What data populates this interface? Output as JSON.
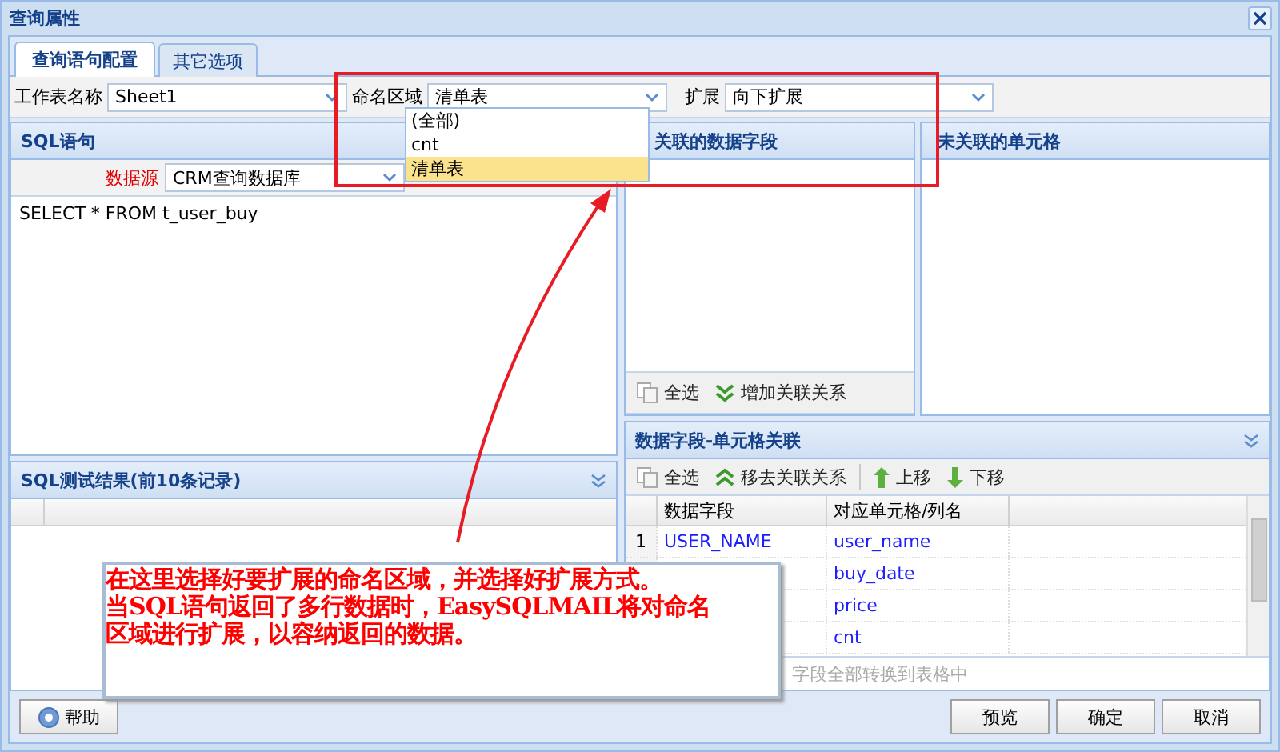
{
  "window": {
    "title": "查询属性"
  },
  "tabs": [
    {
      "label": "查询语句配置",
      "selected": true
    },
    {
      "label": "其它选项",
      "selected": false
    }
  ],
  "form": {
    "sheet": {
      "label": "工作表名称",
      "value": "Sheet1"
    },
    "named_range": {
      "label": "命名区域",
      "value": "清单表",
      "expanded": true,
      "options": [
        {
          "label": "(全部)",
          "selected": false
        },
        {
          "label": "cnt",
          "selected": false
        },
        {
          "label": "清单表",
          "selected": true
        }
      ]
    },
    "expand": {
      "label": "扩展",
      "value": "向下扩展"
    }
  },
  "sql_panel": {
    "title": "SQL语句",
    "datasource_label": "数据源",
    "datasource": "CRM查询数据库",
    "query": "SELECT * FROM t_user_buy"
  },
  "test_panel": {
    "title": "SQL测试结果(前10条记录)"
  },
  "linked_fields_panel": {
    "title": "关联的数据字段",
    "toolbar": [
      {
        "kind": "select-all",
        "label": "全选"
      },
      {
        "kind": "add",
        "label": "增加关联关系"
      }
    ]
  },
  "unlinked_cells_panel": {
    "title": "未关联的单元格"
  },
  "mapping_panel": {
    "title": "数据字段-单元格关联",
    "toolbar": [
      {
        "kind": "select-all",
        "label": "全选"
      },
      {
        "kind": "remove",
        "label": "移去关联关系"
      },
      {
        "kind": "up",
        "label": "上移"
      },
      {
        "kind": "down",
        "label": "下移"
      }
    ],
    "columns": [
      "数据字段",
      "对应单元格/列名"
    ],
    "rows": [
      {
        "number": "1",
        "field": "USER_NAME",
        "cell": "user_name"
      },
      {
        "cell": "buy_date"
      },
      {
        "cell": "price"
      },
      {
        "cell": "cnt"
      }
    ],
    "footer_hint": "字段全部转换到表格中"
  },
  "buttons": {
    "help": "帮助",
    "actions": [
      "预览",
      "确定",
      "取消"
    ]
  },
  "callout": {
    "lines": [
      "在这里选择好要扩展的命名区域，并选择好扩展方式。",
      "当SQL语句返回了多行数据时，EasySQLMAIL将对命名",
      "区域进行扩展，以容纳返回的数据。"
    ]
  }
}
